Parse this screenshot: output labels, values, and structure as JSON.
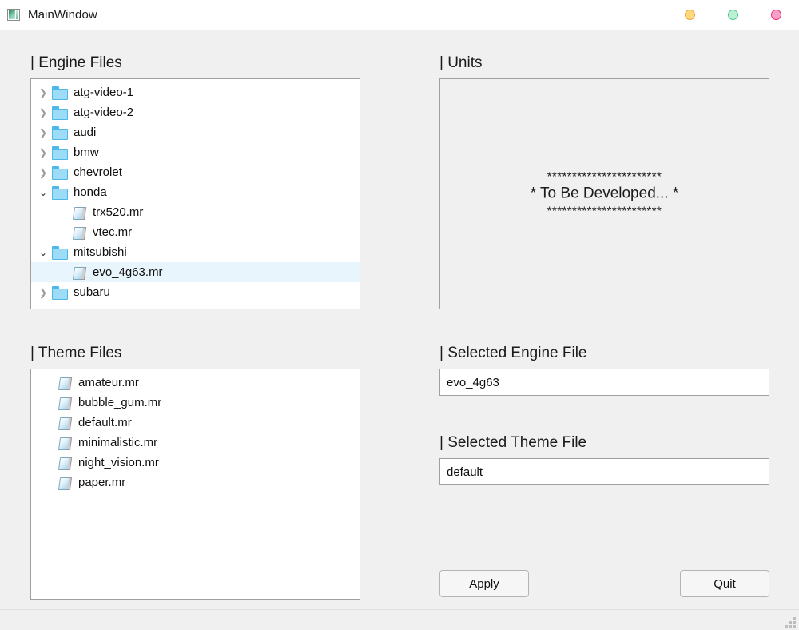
{
  "window": {
    "title": "MainWindow",
    "icon": "app-icon",
    "controls": [
      {
        "name": "minimize",
        "color": "#ffd87e"
      },
      {
        "name": "maximize",
        "color": "#b9f0d2"
      },
      {
        "name": "close",
        "color": "#f9a0c8"
      }
    ]
  },
  "engine_files": {
    "label": "| Engine Files",
    "items": [
      {
        "name": "atg-video-1",
        "type": "folder",
        "depth": 0,
        "state": "collapsed",
        "selected": false
      },
      {
        "name": "atg-video-2",
        "type": "folder",
        "depth": 0,
        "state": "collapsed",
        "selected": false
      },
      {
        "name": "audi",
        "type": "folder",
        "depth": 0,
        "state": "collapsed",
        "selected": false
      },
      {
        "name": "bmw",
        "type": "folder",
        "depth": 0,
        "state": "collapsed",
        "selected": false
      },
      {
        "name": "chevrolet",
        "type": "folder",
        "depth": 0,
        "state": "collapsed",
        "selected": false
      },
      {
        "name": "honda",
        "type": "folder",
        "depth": 0,
        "state": "expanded",
        "selected": false
      },
      {
        "name": "trx520.mr",
        "type": "file",
        "depth": 1,
        "state": "none",
        "selected": false
      },
      {
        "name": "vtec.mr",
        "type": "file",
        "depth": 1,
        "state": "none",
        "selected": false
      },
      {
        "name": "mitsubishi",
        "type": "folder",
        "depth": 0,
        "state": "expanded",
        "selected": false
      },
      {
        "name": "evo_4g63.mr",
        "type": "file",
        "depth": 1,
        "state": "none",
        "selected": true
      },
      {
        "name": "subaru",
        "type": "folder",
        "depth": 0,
        "state": "collapsed",
        "selected": false
      }
    ]
  },
  "theme_files": {
    "label": "| Theme Files",
    "items": [
      {
        "name": "amateur.mr",
        "type": "file",
        "selected": false
      },
      {
        "name": "bubble_gum.mr",
        "type": "file",
        "selected": false
      },
      {
        "name": "default.mr",
        "type": "file",
        "selected": false
      },
      {
        "name": "minimalistic.mr",
        "type": "file",
        "selected": false
      },
      {
        "name": "night_vision.mr",
        "type": "file",
        "selected": false
      },
      {
        "name": "paper.mr",
        "type": "file",
        "selected": false
      }
    ]
  },
  "units": {
    "label": "| Units",
    "stars_top": "***********************",
    "message": "* To Be Developed... *",
    "stars_bottom": "***********************"
  },
  "selected_engine_file": {
    "label": "| Selected Engine File",
    "value": "evo_4g63",
    "placeholder": ""
  },
  "selected_theme_file": {
    "label": "| Selected Theme File",
    "value": "default",
    "placeholder": ""
  },
  "actions": {
    "apply_label": "Apply",
    "quit_label": "Quit"
  },
  "statusbar": {
    "grip": "resize-grip"
  },
  "colors": {
    "background": "#f0f0f0",
    "panel": "#ffffff",
    "border": "#a0a0a0",
    "selection": "#e9f5fd",
    "folder": "#9ddcf7",
    "text": "#101010"
  }
}
